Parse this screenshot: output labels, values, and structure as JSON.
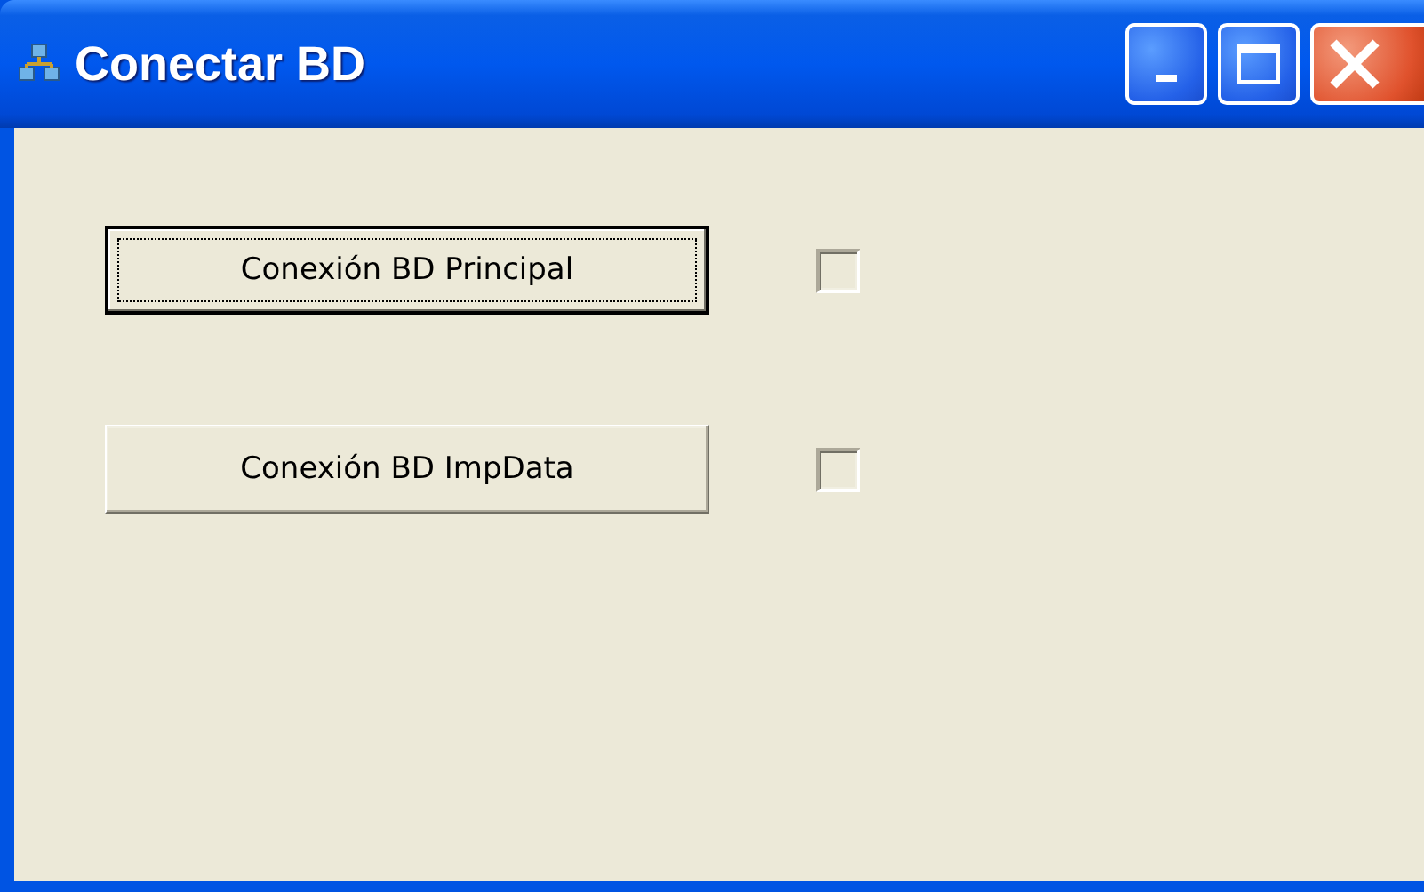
{
  "window": {
    "title": "Conectar BD"
  },
  "rows": [
    {
      "button": {
        "label": "Conexión BD Principal",
        "focused": true
      },
      "checkbox": {
        "checked": false,
        "disabled": true
      }
    },
    {
      "button": {
        "label": "Conexión BD ImpData",
        "focused": false
      },
      "checkbox": {
        "checked": false,
        "disabled": true
      }
    }
  ]
}
